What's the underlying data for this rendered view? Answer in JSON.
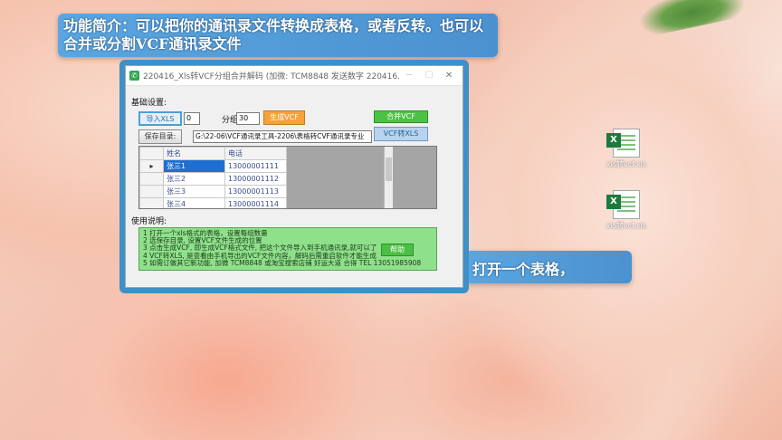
{
  "captions": {
    "top": "功能简介：可以把你的通讯录文件转换成表格，或者反转。也可以合并或分割VCF通讯录文件",
    "right": "打开一个表格，"
  },
  "window": {
    "title": "220416_Xls转VCF分组合并解码 (加微: TCM8848 发送数字 220416...",
    "app_icon": "✆",
    "minimize": "─",
    "maximize": "☐",
    "close": "✕"
  },
  "settings": {
    "group_title": "基础设置:",
    "import_label": "导入XLS",
    "count_value": "0",
    "group_label": "分组",
    "group_value": "30",
    "generate_label": "生成VCF",
    "merge_label": "合并VCF",
    "save_label": "保存目录:",
    "path_value": "G:\\22-06\\VCF通讯录工具-2206\\表格转CVF通讯录专业",
    "vcf_to_xls_label": "VCF转XLS"
  },
  "table": {
    "headers": [
      "姓名",
      "电话"
    ],
    "rows": [
      {
        "name": "张三1",
        "phone": "13000001111",
        "marker": "▸"
      },
      {
        "name": "张三2",
        "phone": "13000001112",
        "marker": ""
      },
      {
        "name": "张三3",
        "phone": "13000001113",
        "marker": ""
      },
      {
        "name": "张三4",
        "phone": "13000001114",
        "marker": ""
      }
    ]
  },
  "help": {
    "group_title": "使用说明:",
    "lines": [
      "1 打开一个xls格式的表格，设置每组数量",
      "2 选保存目录, 设置VCF文件生成的位置",
      "3 点击生成VCF, 即生成VCF格式文件, 把这个文件导入到手机通讯录,就可以了",
      "4 VCF转XLS, 是查看由手机导出的VCF文件内容，解码后需重启软件才能生成",
      "5 如需订做其它新功能, 加微 TCM8848 或淘宝搜索店铺 好运大道 合得  TEL 13051985908"
    ],
    "help_button": "帮助"
  },
  "desktop": {
    "file1": "xls转vcf.xls",
    "file2": "xls转vcf.xls"
  }
}
